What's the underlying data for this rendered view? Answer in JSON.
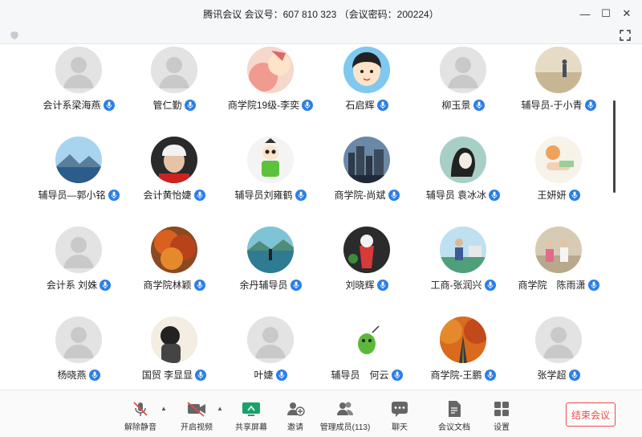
{
  "window": {
    "title": "腾讯会议 会议号：607 810 323 （会议密码：200224）"
  },
  "participants": [
    {
      "name": "会计系梁海燕",
      "avatar": "default"
    },
    {
      "name": "管仁勤",
      "avatar": "default"
    },
    {
      "name": "商学院19级-李奕",
      "avatar": "cartoon-pig"
    },
    {
      "name": "石启辉",
      "avatar": "cartoon-boy"
    },
    {
      "name": "柳玉景",
      "avatar": "default"
    },
    {
      "name": "辅导员-于小青",
      "avatar": "beach-photo"
    },
    {
      "name": "辅导员—郭小铭",
      "avatar": "mountain-lake"
    },
    {
      "name": "会计黄怡婕",
      "avatar": "hockey-player"
    },
    {
      "name": "辅导员刘雍鹤",
      "avatar": "cartoon-figure"
    },
    {
      "name": "商学院-尚斌",
      "avatar": "city-skyline"
    },
    {
      "name": "辅导员 袁冰冰",
      "avatar": "ink-portrait"
    },
    {
      "name": "王妍妍",
      "avatar": "illustration-girl"
    },
    {
      "name": "会计系 刘姝",
      "avatar": "default"
    },
    {
      "name": "商学院林颖",
      "avatar": "autumn-tree"
    },
    {
      "name": "余丹辅导员",
      "avatar": "lake-figure"
    },
    {
      "name": "刘晓辉",
      "avatar": "strawberry-drink"
    },
    {
      "name": "工商-张润兴",
      "avatar": "outdoor-person"
    },
    {
      "name": "商学院　陈雨潇",
      "avatar": "group-photo"
    },
    {
      "name": "杨晓燕",
      "avatar": "default"
    },
    {
      "name": "国贸 李显显",
      "avatar": "girl-back"
    },
    {
      "name": "叶婕",
      "avatar": "default"
    },
    {
      "name": "辅导员　何云",
      "avatar": "green-cartoon"
    },
    {
      "name": "商学院-王鹏",
      "avatar": "autumn-road"
    },
    {
      "name": "张学超",
      "avatar": "default"
    }
  ],
  "toolbar": {
    "unmute": "解除静音",
    "start_video": "开启视频",
    "share_screen": "共享屏幕",
    "invite": "邀请",
    "manage_members": "管理成员(113)",
    "chat": "聊天",
    "documents": "会议文档",
    "settings": "设置",
    "end_meeting": "结束会议"
  },
  "colors": {
    "mic_badge": "#2a7ee8",
    "end_button": "#e84a4a",
    "share_green": "#1aa06b",
    "muted_red": "#e84a4a"
  }
}
